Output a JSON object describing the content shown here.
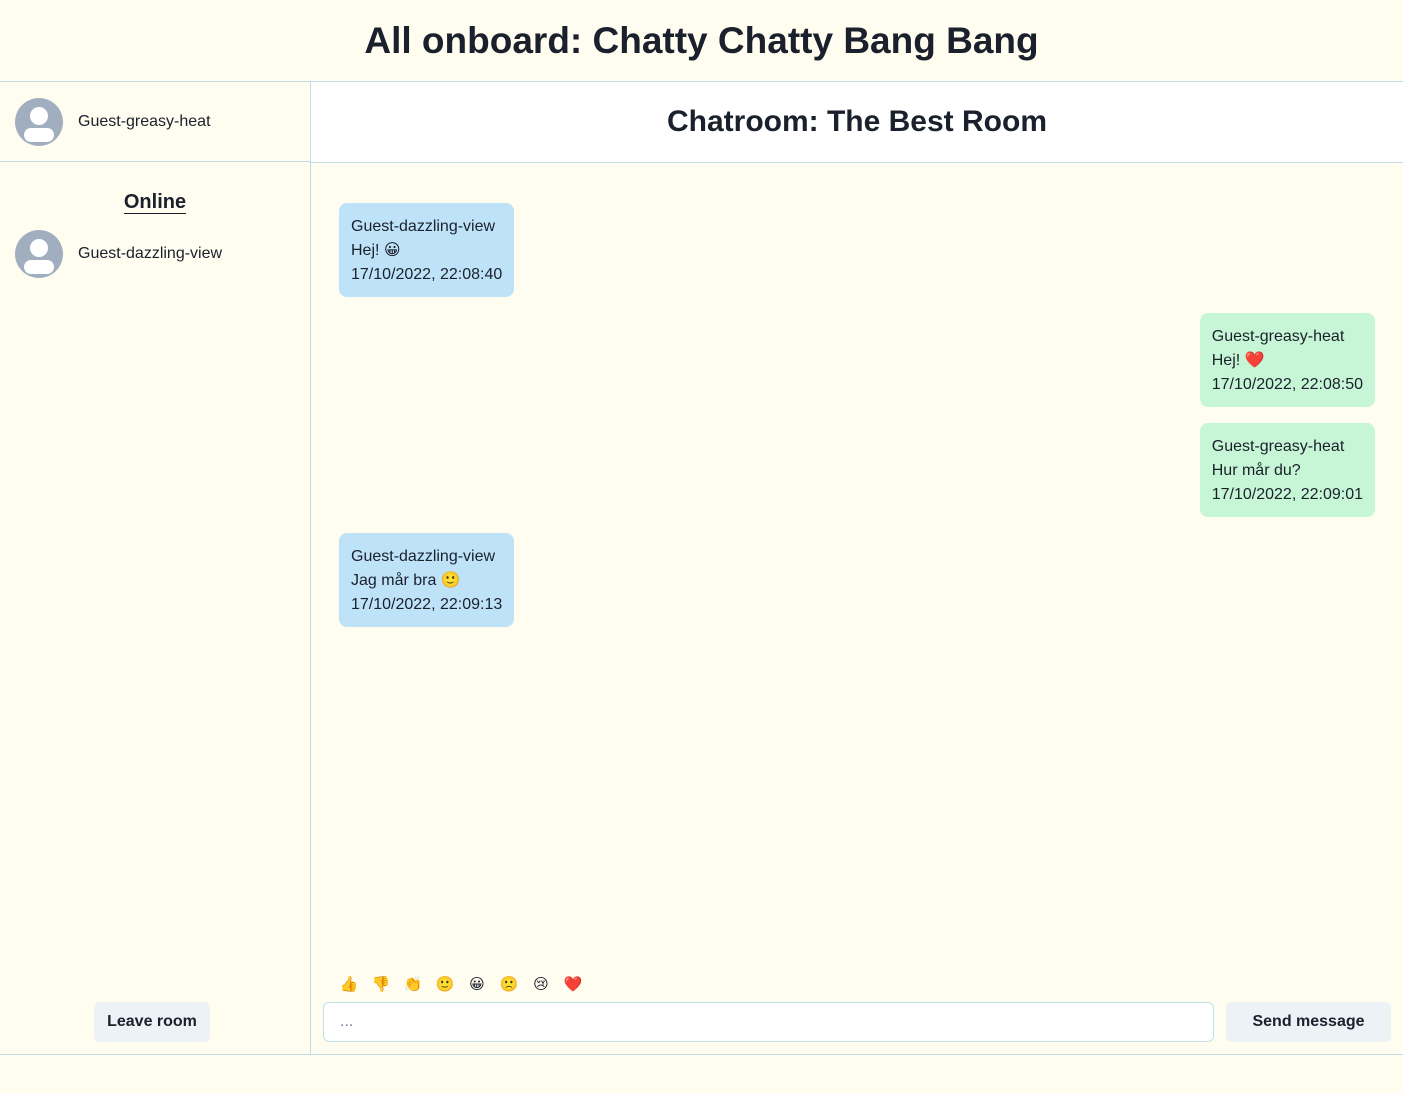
{
  "app": {
    "title": "All onboard: Chatty Chatty Bang Bang"
  },
  "sidebar": {
    "current_user": {
      "name": "Guest-greasy-heat",
      "avatar_icon": "user-avatar-icon"
    },
    "online_title": "Online",
    "online_users": [
      {
        "name": "Guest-dazzling-view",
        "avatar_icon": "user-avatar-icon"
      }
    ],
    "leave_label": "Leave room"
  },
  "chat": {
    "title": "Chatroom: The Best Room",
    "messages": [
      {
        "direction": "incoming",
        "author": "Guest-dazzling-view",
        "text": "Hej! 😀",
        "time": "17/10/2022, 22:08:40"
      },
      {
        "direction": "outgoing",
        "author": "Guest-greasy-heat",
        "text": "Hej! ❤️",
        "time": "17/10/2022, 22:08:50"
      },
      {
        "direction": "outgoing",
        "author": "Guest-greasy-heat",
        "text": "Hur mår du?",
        "time": "17/10/2022, 22:09:01"
      },
      {
        "direction": "incoming",
        "author": "Guest-dazzling-view",
        "text": "Jag mår bra 🙂",
        "time": "17/10/2022, 22:09:13"
      }
    ]
  },
  "composer": {
    "emojis": [
      "👍",
      "👎",
      "👏",
      "🙂",
      "😀",
      "🙁",
      "😢",
      "❤️"
    ],
    "placeholder": "...",
    "value": "",
    "send_label": "Send message"
  },
  "colors": {
    "background": "#fffdef",
    "incoming_bubble": "#bee3f8",
    "outgoing_bubble": "#c6f6d5",
    "border": "#bfdbe6",
    "button": "#edf2f7",
    "avatar": "#a0aec0"
  }
}
